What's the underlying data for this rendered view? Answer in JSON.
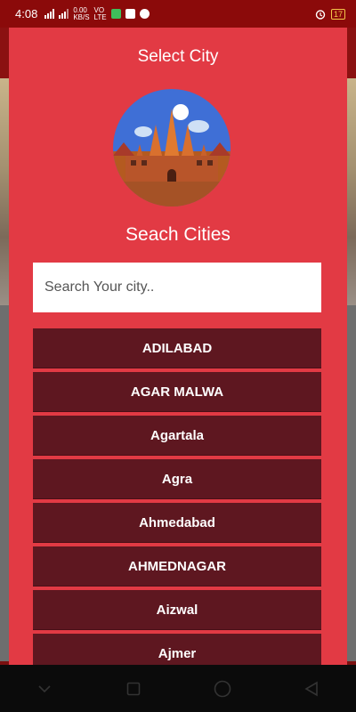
{
  "status_bar": {
    "time": "4:08",
    "net_speed": "0.00\nKB/S",
    "volte": "VO\nLTE",
    "battery": "17"
  },
  "dialog": {
    "title": "Select City",
    "subtitle": "Seach Cities",
    "search": {
      "placeholder": "Search Your city..",
      "value": ""
    },
    "cities": [
      "ADILABAD",
      "AGAR MALWA",
      "Agartala",
      "Agra",
      "Ahmedabad",
      "AHMEDNAGAR",
      "Aizwal",
      "Ajmer"
    ]
  },
  "colors": {
    "panel": "#e23a44",
    "list_item": "#5e1720",
    "status_bar": "#8b0a0a",
    "nav_bar": "#0b0b0b"
  },
  "icons": {
    "logo": "city-skyline-icon",
    "nav": [
      "back-chevron-icon",
      "recent-apps-icon",
      "home-circle-icon",
      "back-triangle-icon"
    ]
  }
}
